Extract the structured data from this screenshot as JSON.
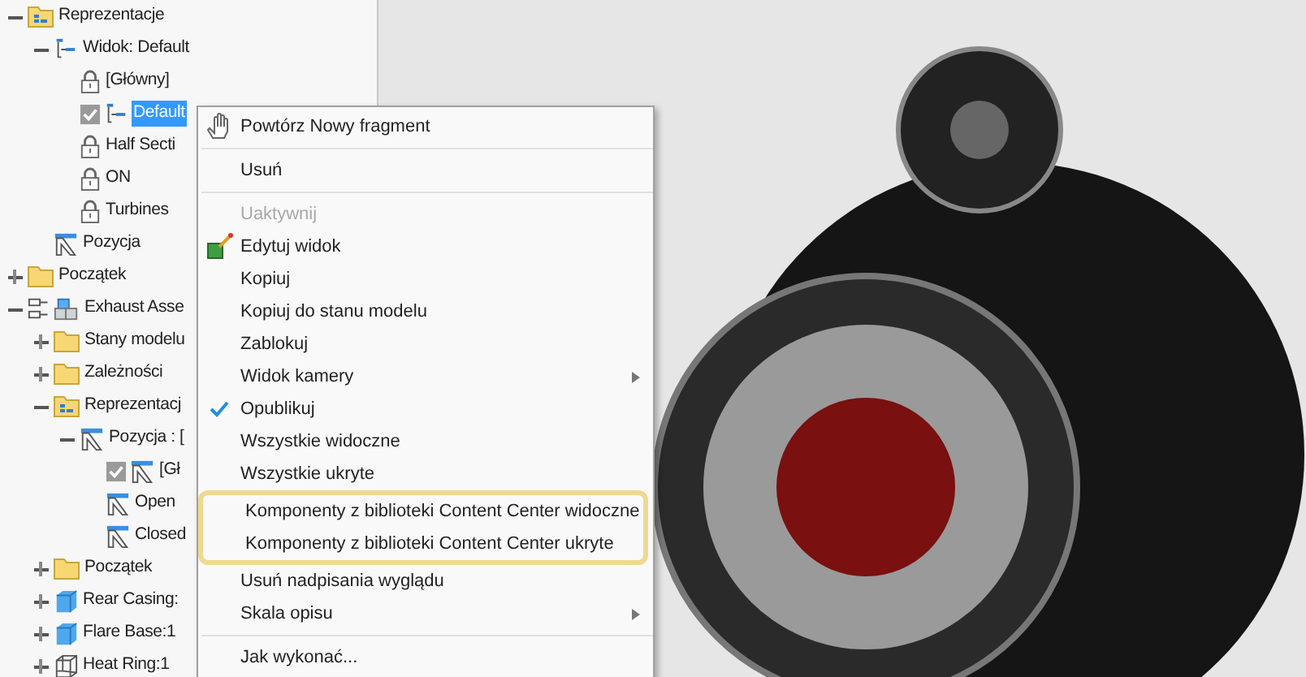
{
  "tree": [
    {
      "label": "Reprezentacje",
      "kind": "rep-folder",
      "expanded": true,
      "children": [
        {
          "label": "Widok: Default",
          "kind": "view",
          "expanded": true,
          "children": [
            {
              "label": "[Główny]",
              "kind": "lock"
            },
            {
              "label": "Default",
              "kind": "check-view",
              "selected": true
            },
            {
              "label": "Half Secti",
              "kind": "lock"
            },
            {
              "label": "ON",
              "kind": "lock"
            },
            {
              "label": "Turbines",
              "kind": "lock"
            }
          ]
        },
        {
          "label": "Pozycja",
          "kind": "position"
        }
      ]
    },
    {
      "label": "Początek",
      "kind": "folder",
      "expanded": false
    },
    {
      "label": "Exhaust Asse",
      "kind": "assembly",
      "expanded": true,
      "children": [
        {
          "label": "Stany modelu",
          "kind": "folder",
          "expanded": false
        },
        {
          "label": "Zależności",
          "kind": "folder",
          "expanded": false
        },
        {
          "label": "Reprezentacj",
          "kind": "rep-folder",
          "expanded": true,
          "children": [
            {
              "label": "Pozycja : [",
              "kind": "position",
              "expanded": true,
              "children": [
                {
                  "label": "[Gł",
                  "kind": "check-position"
                },
                {
                  "label": "Open",
                  "kind": "position"
                },
                {
                  "label": "Closed",
                  "kind": "position"
                }
              ]
            }
          ]
        },
        {
          "label": "Początek",
          "kind": "folder",
          "expanded": false
        },
        {
          "label": "Rear Casing:",
          "kind": "part",
          "expanded": false
        },
        {
          "label": "Flare Base:1",
          "kind": "part",
          "expanded": false
        },
        {
          "label": "Heat Ring:1",
          "kind": "wire-part",
          "expanded": false
        }
      ]
    }
  ],
  "context_menu": [
    {
      "kind": "hand-item",
      "label": "Powtórz Nowy fragment"
    },
    {
      "kind": "separator"
    },
    {
      "kind": "item",
      "label": "Usuń"
    },
    {
      "kind": "separator"
    },
    {
      "kind": "item",
      "label": "Uaktywnij",
      "disabled": true
    },
    {
      "kind": "edit-item",
      "label": "Edytuj widok"
    },
    {
      "kind": "item",
      "label": "Kopiuj"
    },
    {
      "kind": "item",
      "label": "Kopiuj do stanu modelu"
    },
    {
      "kind": "item",
      "label": "Zablokuj"
    },
    {
      "kind": "item",
      "label": "Widok kamery",
      "submenu": true
    },
    {
      "kind": "item",
      "label": "Opublikuj",
      "checked": true
    },
    {
      "kind": "item",
      "label": "Wszystkie widoczne"
    },
    {
      "kind": "item",
      "label": "Wszystkie ukryte"
    },
    {
      "kind": "highlight_group",
      "items": [
        {
          "kind": "item",
          "label": "Komponenty z biblioteki Content Center widoczne"
        },
        {
          "kind": "item",
          "label": "Komponenty z biblioteki Content Center ukryte"
        }
      ]
    },
    {
      "kind": "item",
      "label": "Usuń nadpisania wyglądu"
    },
    {
      "kind": "item",
      "label": "Skala opisu",
      "submenu": true
    },
    {
      "kind": "separator"
    },
    {
      "kind": "item",
      "label": "Jak wykonać..."
    }
  ]
}
